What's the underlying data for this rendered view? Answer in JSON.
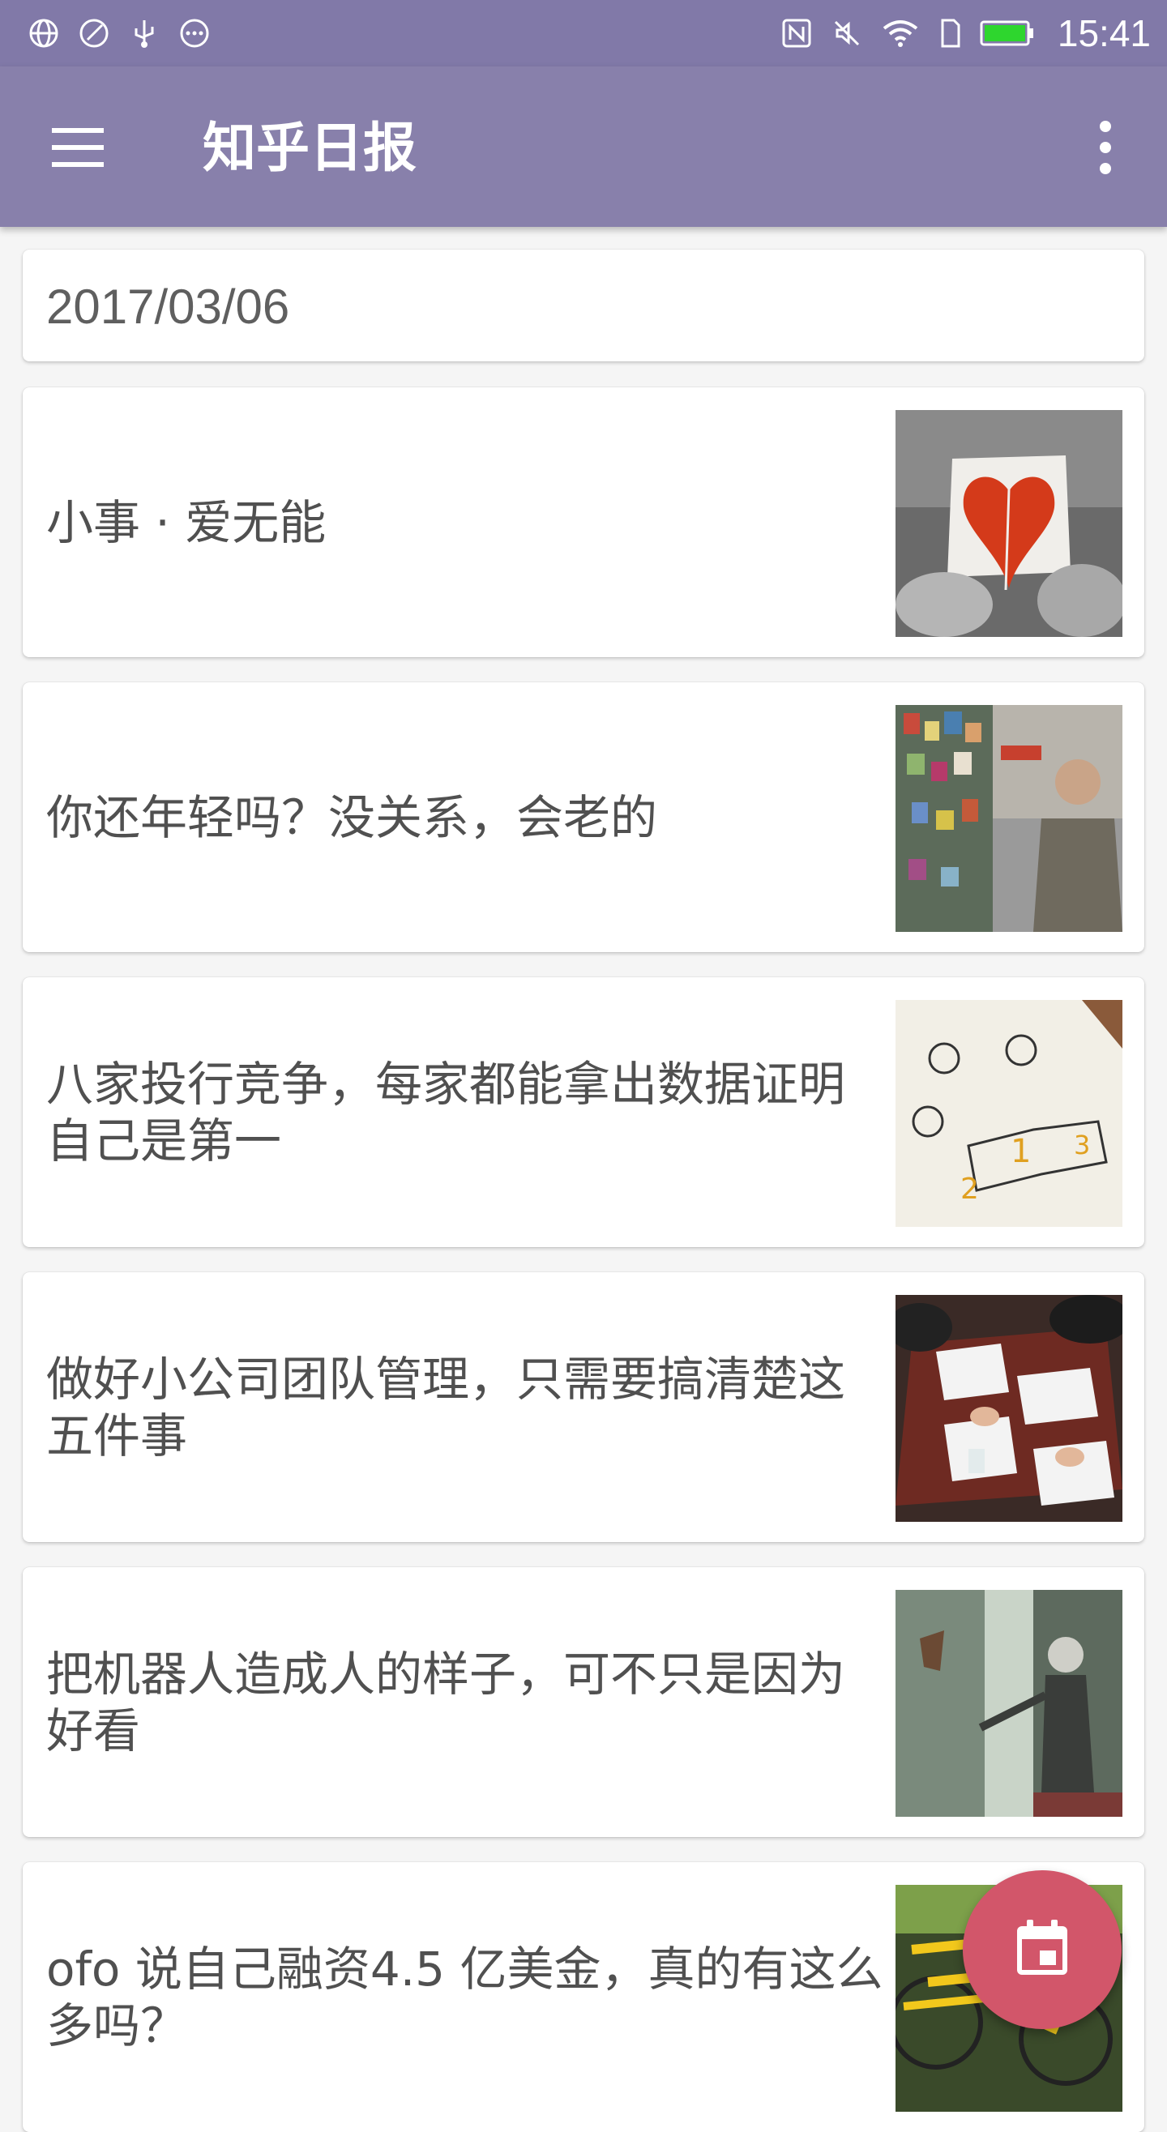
{
  "status_bar": {
    "time": "15:41",
    "left_icons": [
      "globe-icon",
      "no-disturb-icon",
      "usb-icon",
      "more-notifications-icon"
    ],
    "right_icons": [
      "nfc-icon",
      "mute-icon",
      "wifi-icon",
      "sim-icon",
      "battery-icon"
    ],
    "battery_color": "#2ed62e"
  },
  "app_bar": {
    "title": "知乎日报",
    "color": "#8880ab"
  },
  "date_header": "2017/03/06",
  "stories": [
    {
      "title": "小事 · 爱无能",
      "thumb": "broken-heart-paper-image"
    },
    {
      "title": "你还年轻吗？没关系，会老的",
      "thumb": "old-man-street-image"
    },
    {
      "title": "八家投行竞争，每家都能拿出数据证明自己是第一",
      "thumb": "podium-sketch-image"
    },
    {
      "title": "做好小公司团队管理，只需要搞清楚这五件事",
      "thumb": "meeting-table-image"
    },
    {
      "title": "把机器人造成人的样子，可不只是因为好看",
      "thumb": "humanoid-robot-image"
    },
    {
      "title": "ofo 说自己融资4.5 亿美金，真的有这么多吗？",
      "thumb": "yellow-bikes-image"
    }
  ],
  "fab": {
    "icon": "calendar-icon",
    "color": "#d2566a"
  }
}
